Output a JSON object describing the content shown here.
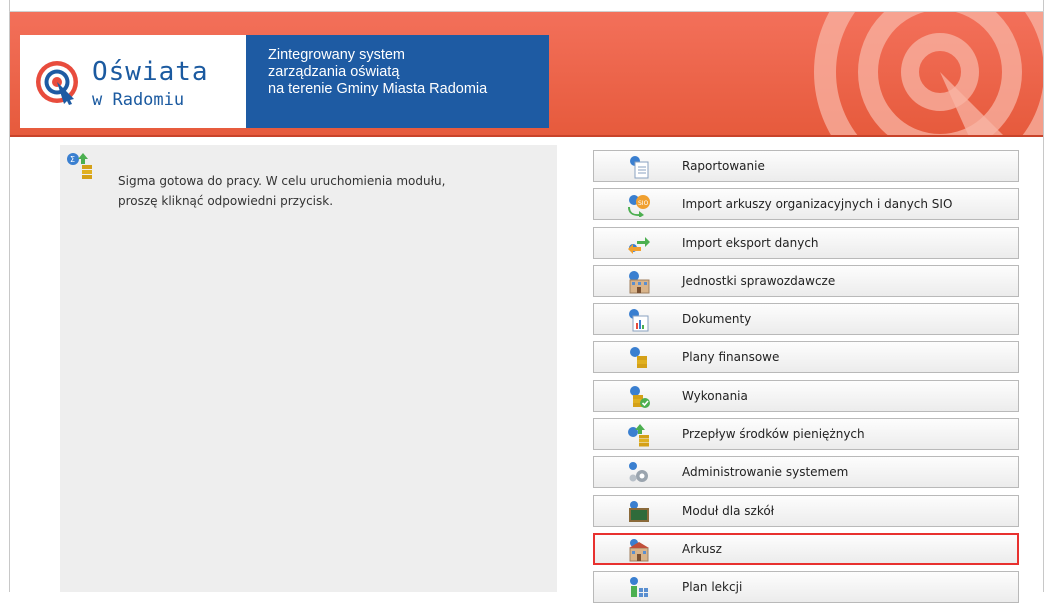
{
  "header": {
    "logo_title": "Oświata",
    "logo_subtitle": "w Radomiu",
    "tagline": [
      "Zintegrowany system",
      "zarządzania oświatą",
      "na terenie Gminy Miasta Radomia"
    ]
  },
  "status": {
    "line1": "Sigma gotowa do pracy. W celu uruchomienia modułu,",
    "line2": "proszę kliknąć odpowiedni przycisk."
  },
  "modules": [
    {
      "label": "Raportowanie",
      "icon": "report-icon"
    },
    {
      "label": "Import arkuszy organizacyjnych i danych SIO",
      "icon": "sio-import-icon"
    },
    {
      "label": "Import eksport danych",
      "icon": "import-export-icon"
    },
    {
      "label": "Jednostki sprawozdawcze",
      "icon": "building-icon"
    },
    {
      "label": "Dokumenty",
      "icon": "documents-chart-icon"
    },
    {
      "label": "Plany finansowe",
      "icon": "coins-icon"
    },
    {
      "label": "Wykonania",
      "icon": "coins-check-icon"
    },
    {
      "label": "Przepływ środków pieniężnych",
      "icon": "cashflow-icon"
    },
    {
      "label": "Administrowanie systemem",
      "icon": "gears-icon"
    },
    {
      "label": "Moduł dla szkół",
      "icon": "blackboard-icon"
    },
    {
      "label": "Arkusz",
      "icon": "school-sheet-icon"
    },
    {
      "label": "Plan lekcji",
      "icon": "schedule-icon"
    }
  ],
  "selected_module": "Arkusz",
  "colors": {
    "header_red": "#e65a3c",
    "tagline_blue": "#1e5ba3",
    "selection_red": "#e8312f"
  }
}
